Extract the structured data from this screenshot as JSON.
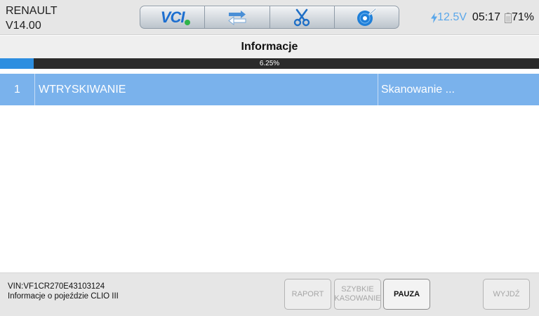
{
  "header": {
    "brand_name": "RENAULT",
    "version": "V14.00",
    "toolbar": {
      "vci_label": "VCI",
      "icons": [
        "vci-icon",
        "transfer-icon",
        "scissors-icon",
        "disc-icon"
      ]
    },
    "voltage": "12.5V",
    "time": "05:17",
    "battery": "71%"
  },
  "page": {
    "title": "Informacje"
  },
  "progress": {
    "value_fraction": 0.0625,
    "label": "6.25%"
  },
  "table": {
    "rows": [
      {
        "index": "1",
        "name": "WTRYSKIWANIE",
        "status": "Skanowanie ..."
      }
    ]
  },
  "footer": {
    "vin": "VIN:VF1CR270E43103124",
    "vehicle_info": "Informacje o pojeździe CLIO III",
    "buttons": {
      "raport": "RAPORT",
      "szybkie_line1": "SZYBKIE",
      "szybkie_line2": "KASOWANIE",
      "pauza": "PAUZA",
      "wyjdz": "WYJDŹ"
    }
  },
  "colors": {
    "accent_blue": "#2d8ee0",
    "row_highlight": "#7ab2ec",
    "voltage_blue": "#5aa7ea"
  }
}
